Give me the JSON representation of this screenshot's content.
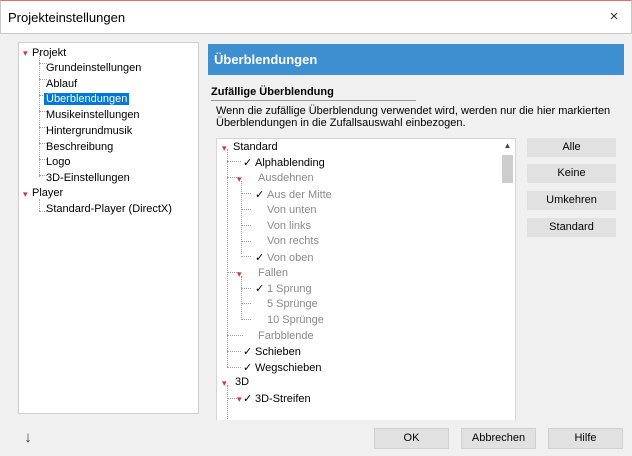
{
  "window": {
    "title": "Projekteinstellungen",
    "close_glyph": "×"
  },
  "tree": {
    "projekt": "Projekt",
    "items": [
      "Grundeinstellungen",
      "Ablauf",
      "Überblendungen",
      "Musikeinstellungen",
      "Hintergrundmusik",
      "Beschreibung",
      "Logo",
      "3D-Einstellungen"
    ],
    "player": "Player",
    "player_item": "Standard-Player (DirectX)"
  },
  "main": {
    "header": "Überblendungen",
    "group": "Zufällige Überblendung",
    "description": "Wenn die zufällige Überblendung verwendet wird, werden nur die hier markierten Überblendungen in die Zufallsauswahl einbezogen."
  },
  "list": {
    "standard": "Standard",
    "alphablending": "Alphablending",
    "ausdehnen": "Ausdehnen",
    "aus_der_mitte": "Aus der Mitte",
    "von_unten": "Von unten",
    "von_links": "Von links",
    "von_rechts": "Von rechts",
    "von_oben": "Von oben",
    "fallen": "Fallen",
    "sprung1": "1 Sprung",
    "sprung5": "5 Sprünge",
    "sprung10": "10 Sprünge",
    "farbblende": "Farbblende",
    "schieben": "Schieben",
    "wegschieben": "Wegschieben",
    "d3": "3D",
    "streifen": "3D-Streifen",
    "check_glyph": "✓"
  },
  "buttons": {
    "alle": "Alle",
    "keine": "Keine",
    "umkehren": "Umkehren",
    "standard": "Standard"
  },
  "footer": {
    "ok": "OK",
    "abbrechen": "Abbrechen",
    "hilfe": "Hilfe",
    "arrow": "↓"
  }
}
